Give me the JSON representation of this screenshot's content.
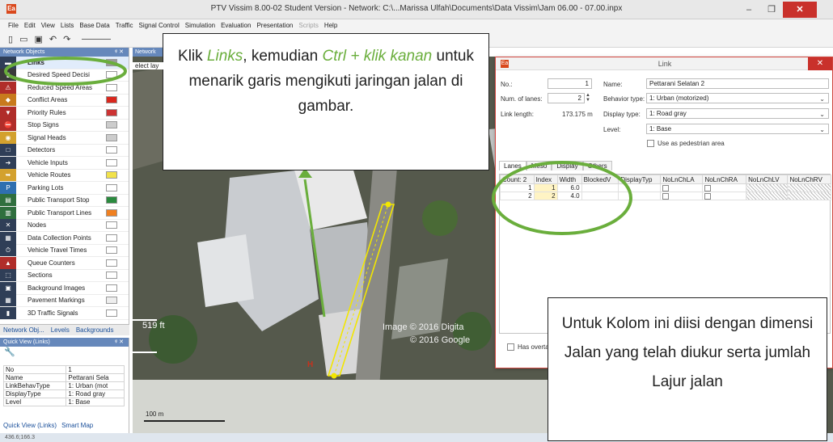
{
  "window": {
    "title": "PTV Vissim 8.00-02 Student Version - Network: C:\\...Marissa Ulfah\\Documents\\Data Vissim\\Jam 06.00 - 07.00.inpx",
    "app_icon": "Ea",
    "minimize": "–",
    "maximize": "❐",
    "close": "✕"
  },
  "menu": [
    "File",
    "Edit",
    "View",
    "Lists",
    "Base Data",
    "Traffic",
    "Signal Control",
    "Simulation",
    "Evaluation",
    "Presentation",
    "Scripts",
    "Help"
  ],
  "menu_disabled": [
    "Scripts"
  ],
  "network_objects": {
    "header": "Network Objects",
    "items": [
      {
        "label": "Links",
        "icon": "link-icon",
        "selected": true
      },
      {
        "label": "Desired Speed Decisi",
        "icon": "speed-decision-icon"
      },
      {
        "label": "Reduced Speed Areas",
        "icon": "reduced-speed-icon"
      },
      {
        "label": "Conflict Areas",
        "icon": "conflict-area-icon"
      },
      {
        "label": "Priority Rules",
        "icon": "priority-rule-icon"
      },
      {
        "label": "Stop Signs",
        "icon": "stop-sign-icon"
      },
      {
        "label": "Signal Heads",
        "icon": "signal-head-icon"
      },
      {
        "label": "Detectors",
        "icon": "detector-icon"
      },
      {
        "label": "Vehicle Inputs",
        "icon": "vehicle-input-icon"
      },
      {
        "label": "Vehicle Routes",
        "icon": "vehicle-route-icon"
      },
      {
        "label": "Parking Lots",
        "icon": "parking-icon"
      },
      {
        "label": "Public Transport Stop",
        "icon": "pt-stop-icon"
      },
      {
        "label": "Public Transport Lines",
        "icon": "pt-line-icon"
      },
      {
        "label": "Nodes",
        "icon": "node-icon"
      },
      {
        "label": "Data Collection Points",
        "icon": "data-collection-icon"
      },
      {
        "label": "Vehicle Travel Times",
        "icon": "travel-time-icon"
      },
      {
        "label": "Queue Counters",
        "icon": "queue-counter-icon"
      },
      {
        "label": "Sections",
        "icon": "section-icon"
      },
      {
        "label": "Background Images",
        "icon": "background-image-icon"
      },
      {
        "label": "Pavement Markings",
        "icon": "pavement-marking-icon"
      },
      {
        "label": "3D Traffic Signals",
        "icon": "3d-signal-icon"
      }
    ],
    "tabs": [
      "Network Obj...",
      "Levels",
      "Backgrounds"
    ]
  },
  "quick_view": {
    "header": "Quick View (Links)",
    "rows": [
      {
        "key": "No",
        "value": "1"
      },
      {
        "key": "Name",
        "value": "Pettarani Sela"
      },
      {
        "key": "LinkBehavType",
        "value": "1: Urban (mot"
      },
      {
        "key": "DisplayType",
        "value": "1: Road gray"
      },
      {
        "key": "Level",
        "value": "1: Base"
      }
    ],
    "tabs": [
      "Quick View (Links)",
      "Smart Map"
    ]
  },
  "status_bar": "436.6;166.3",
  "map": {
    "tab": "Network",
    "select_label": "elect lay",
    "scale_top": "519 ft",
    "scale_bottom": "100 m",
    "watermark_1": "Image © 2016 Digita",
    "watermark_2": "© 2016 Google",
    "marker": "H"
  },
  "link_dialog": {
    "title": "Link",
    "no_label": "No.:",
    "no_value": "1",
    "num_lanes_label": "Num. of lanes:",
    "num_lanes_value": "2",
    "link_length_label": "Link length:",
    "link_length_value": "173.175 m",
    "name_label": "Name:",
    "name_value": "Pettarani Selatan 2",
    "behavior_label": "Behavior type:",
    "behavior_value": "1: Urban (motorized)",
    "display_label": "Display type:",
    "display_value": "1: Road gray",
    "level_label": "Level:",
    "level_value": "1: Base",
    "pedestrian_label": "Use as pedestrian area",
    "tabs": [
      "Lanes",
      "Meso",
      "Display",
      "Others"
    ],
    "grid_headers": [
      "Count: 2",
      "Index",
      "Width",
      "BlockedV",
      "DisplayTyp",
      "NoLnChLA",
      "NoLnChRA",
      "NoLnChLV",
      "NoLnChRV"
    ],
    "grid_rows": [
      {
        "count": "1",
        "index": "1",
        "width": "6.0"
      },
      {
        "count": "2",
        "index": "2",
        "width": "4.0"
      }
    ],
    "overtake_label": "Has overta"
  },
  "callouts": {
    "box1_part1": "Klik ",
    "box1_links": "Links",
    "box1_part2": ", kemudian ",
    "box1_ctrl": "Ctrl + klik kanan",
    "box1_part3": " untuk menarik garis mengikuti jaringan jalan di gambar.",
    "box2_text": "Untuk Kolom ini diisi dengan dimensi Jalan yang telah diukur serta jumlah Lajur jalan"
  },
  "colors": {
    "highlight_green": "#6aae3c",
    "panel_header": "#6688bb",
    "close_red": "#c9312b",
    "link_yellow": "#f2e600"
  }
}
